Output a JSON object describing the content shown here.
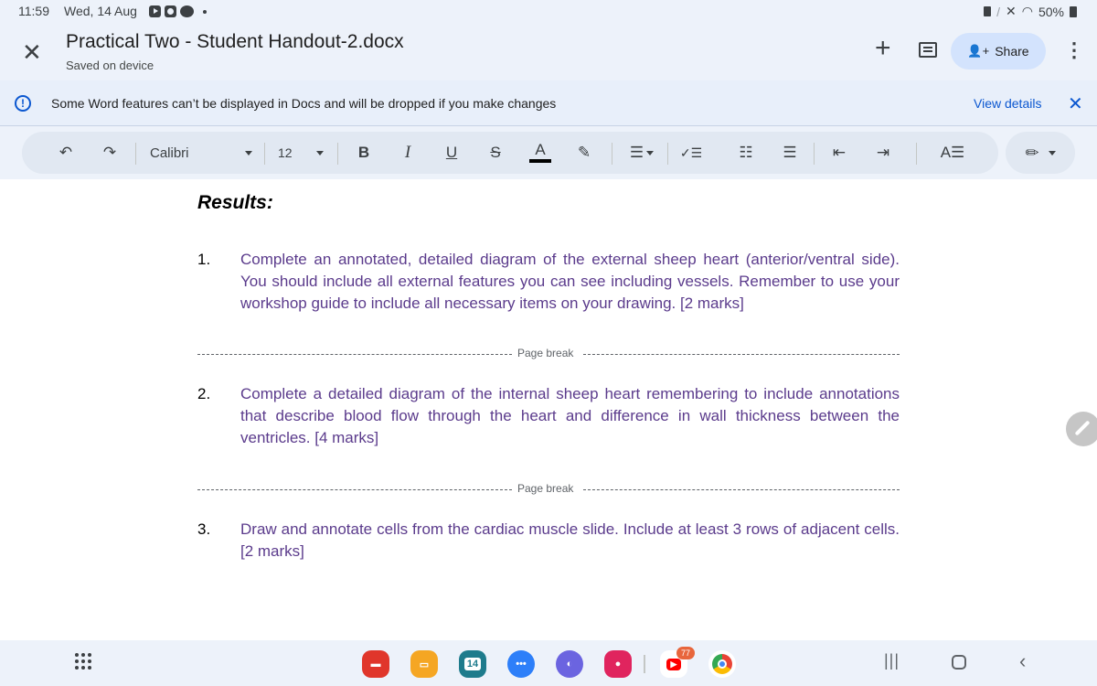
{
  "status_bar": {
    "time": "11:59",
    "date": "Wed, 14 Aug",
    "notification_icons": [
      "youtube-icon",
      "clock-icon",
      "talk-icon"
    ],
    "system_icons": [
      "sd-card-icon",
      "stylus-icon",
      "mute-icon",
      "wifi-icon"
    ],
    "battery": "50%"
  },
  "header": {
    "title": "Practical Two - Student Handout-2.docx",
    "subtitle": "Saved on device",
    "share_label": "Share"
  },
  "banner": {
    "message": "Some Word features can’t be displayed in Docs and will be dropped if you make changes",
    "link": "View details"
  },
  "toolbar": {
    "font": "Calibri",
    "font_size": "12",
    "bold": "B",
    "italic": "I",
    "underline": "U",
    "text_color": "A",
    "text_color_swatch": "#000000"
  },
  "document": {
    "heading": "Results:",
    "page_break_label": "Page break",
    "questions": [
      {
        "number": "1.",
        "text": "Complete an annotated, detailed diagram of the external sheep heart (anterior/ventral side). You should include all external features you can see including vessels. Remember to use your workshop guide to include all necessary items on your drawing. [2 marks]"
      },
      {
        "number": "2.",
        "text": "Complete a detailed diagram of the internal sheep heart remembering to include annotations that describe blood flow through the heart and difference in wall thickness between the ventricles. [4 marks]"
      },
      {
        "number": "3.",
        "text": "Draw and annotate cells from the cardiac muscle slide. Include at least 3 rows of adjacent cells. [2 marks]"
      }
    ],
    "text_color": "#5b3b8c"
  },
  "dock": {
    "apps": [
      {
        "name": "samsung-notes",
        "color": "#e0362b"
      },
      {
        "name": "my-files",
        "color": "#f5a623"
      },
      {
        "name": "calendar",
        "color": "#1e7b8c",
        "label": "14"
      },
      {
        "name": "messages",
        "color": "#2d7ff9"
      },
      {
        "name": "internet",
        "color": "#6b64e0"
      },
      {
        "name": "camera",
        "color": "#e0245e"
      },
      {
        "name": "youtube",
        "color": "#ff0000",
        "badge": "77"
      },
      {
        "name": "chrome",
        "color": "#ffffff"
      }
    ]
  }
}
